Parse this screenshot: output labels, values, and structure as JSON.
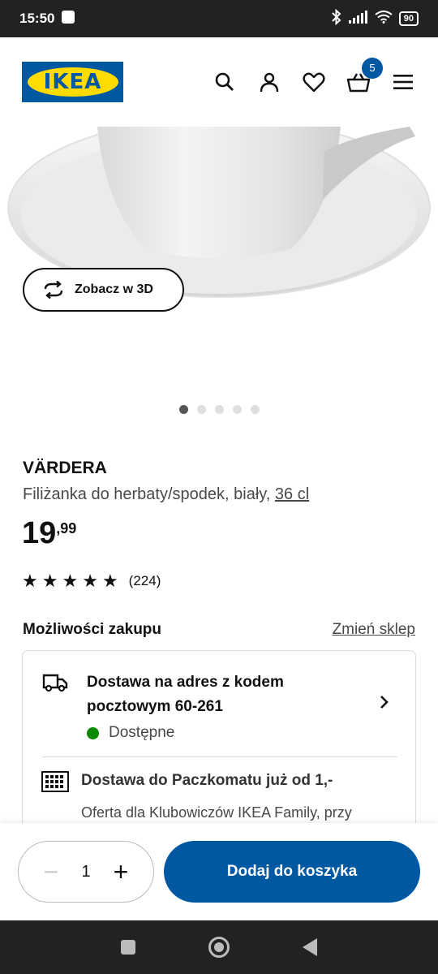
{
  "status_bar": {
    "time": "15:50",
    "battery": "90"
  },
  "header": {
    "logo_text": "IKEA",
    "cart_count": "5"
  },
  "hero": {
    "view3d_label": "Zobacz w 3D",
    "carousel_total": 5,
    "carousel_active": 1
  },
  "product": {
    "name": "VÄRDERA",
    "description": "Filiżanka do herbaty/spodek, biały,",
    "size": "36 cl",
    "price_main": "19",
    "price_decimal": ",99",
    "rating_stars": 5,
    "rating_count": "(224)"
  },
  "purchase": {
    "title": "Możliwości zakupu",
    "change_store": "Zmień sklep",
    "delivery_title": "Dostawa na adres z kodem pocztowym 60-261",
    "delivery_status": "Dostępne",
    "parcel_title": "Dostawa do Paczkomatu już od 1,-",
    "parcel_text": "Oferta dla Klubowiczów IKEA Family, przy"
  },
  "cart_bar": {
    "quantity": "1",
    "add_label": "Dodaj do koszyka"
  },
  "colors": {
    "ikea_blue": "#0058a3",
    "ikea_yellow": "#ffdb00",
    "available_green": "#0a8a00"
  }
}
